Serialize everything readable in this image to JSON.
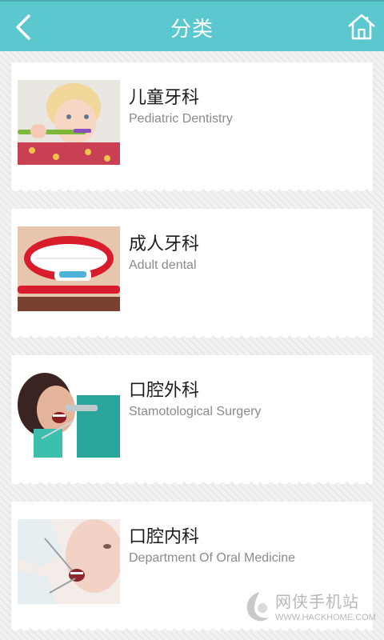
{
  "header": {
    "title": "分类",
    "back_icon": "chevron-left-icon",
    "home_icon": "home-icon",
    "color": "#5bc8cf"
  },
  "categories": [
    {
      "title": "儿童牙科",
      "subtitle": "Pediatric Dentistry"
    },
    {
      "title": "成人牙科",
      "subtitle": "Adult dental"
    },
    {
      "title": "口腔外科",
      "subtitle": "Stamotological Surgery"
    },
    {
      "title": "口腔内科",
      "subtitle": "Department Of Oral Medicine"
    }
  ],
  "watermark": {
    "text": "网侠手机站",
    "url": "WWW.HACKHOME.COM"
  }
}
